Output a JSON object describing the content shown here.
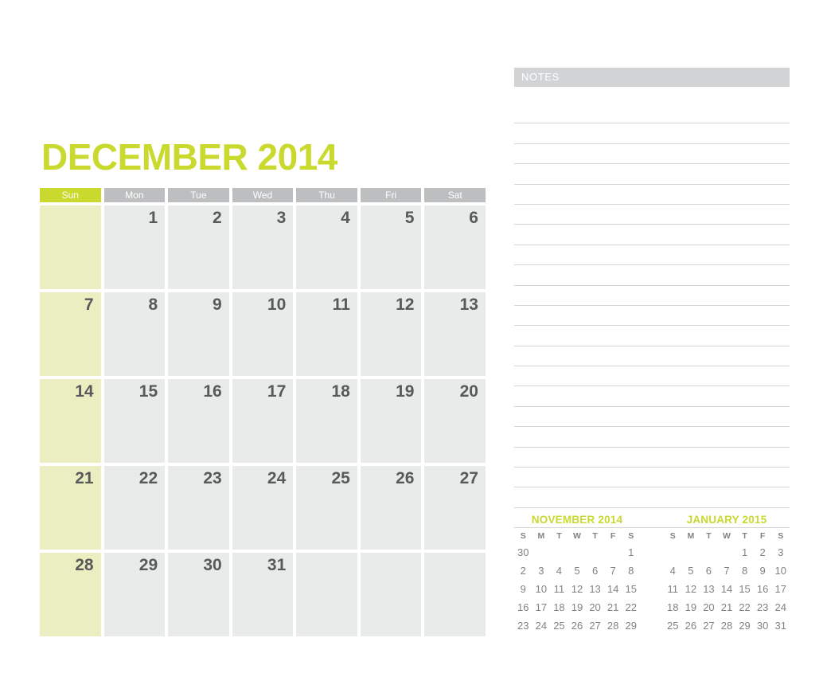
{
  "main_calendar": {
    "title": "DECEMBER 2014",
    "title_color": "#c9d92e",
    "weekday_headers": [
      "Sun",
      "Mon",
      "Tue",
      "Wed",
      "Thu",
      "Fri",
      "Sat"
    ],
    "header_colors": {
      "sunday": "#c9d92e",
      "weekday": "#bcbec0"
    },
    "cell_colors": {
      "sunday": "#ebeec0",
      "weekday": "#e9eaea"
    },
    "day_number_color": "#58595b",
    "weeks": [
      [
        "",
        "1",
        "2",
        "3",
        "4",
        "5",
        "6"
      ],
      [
        "7",
        "8",
        "9",
        "10",
        "11",
        "12",
        "13"
      ],
      [
        "14",
        "15",
        "16",
        "17",
        "18",
        "19",
        "20"
      ],
      [
        "21",
        "22",
        "23",
        "24",
        "25",
        "26",
        "27"
      ],
      [
        "28",
        "29",
        "30",
        "31",
        "",
        "",
        ""
      ]
    ]
  },
  "notes": {
    "header_label": "NOTES",
    "header_bg": "#d2d3d5",
    "line_color": "#d4d4d4",
    "line_count": 21,
    "lines": [
      "",
      "",
      "",
      "",
      "",
      "",
      "",
      "",
      "",
      "",
      "",
      "",
      "",
      "",
      "",
      "",
      "",
      "",
      "",
      "",
      ""
    ]
  },
  "mini_calendars": [
    {
      "title": "NOVEMBER 2014",
      "weekday_headers": [
        "S",
        "M",
        "T",
        "W",
        "T",
        "F",
        "S"
      ],
      "weeks": [
        [
          "30",
          "",
          "",
          "",
          "",
          "",
          "1"
        ],
        [
          "2",
          "3",
          "4",
          "5",
          "6",
          "7",
          "8"
        ],
        [
          "9",
          "10",
          "11",
          "12",
          "13",
          "14",
          "15"
        ],
        [
          "16",
          "17",
          "18",
          "19",
          "20",
          "21",
          "22"
        ],
        [
          "23",
          "24",
          "25",
          "26",
          "27",
          "28",
          "29"
        ]
      ]
    },
    {
      "title": "JANUARY 2015",
      "weekday_headers": [
        "S",
        "M",
        "T",
        "W",
        "T",
        "F",
        "S"
      ],
      "weeks": [
        [
          "",
          "",
          "",
          "",
          "1",
          "2",
          "3"
        ],
        [
          "4",
          "5",
          "6",
          "7",
          "8",
          "9",
          "10"
        ],
        [
          "11",
          "12",
          "13",
          "14",
          "15",
          "16",
          "17"
        ],
        [
          "18",
          "19",
          "20",
          "21",
          "22",
          "23",
          "24"
        ],
        [
          "25",
          "26",
          "27",
          "28",
          "29",
          "30",
          "31"
        ]
      ]
    }
  ]
}
